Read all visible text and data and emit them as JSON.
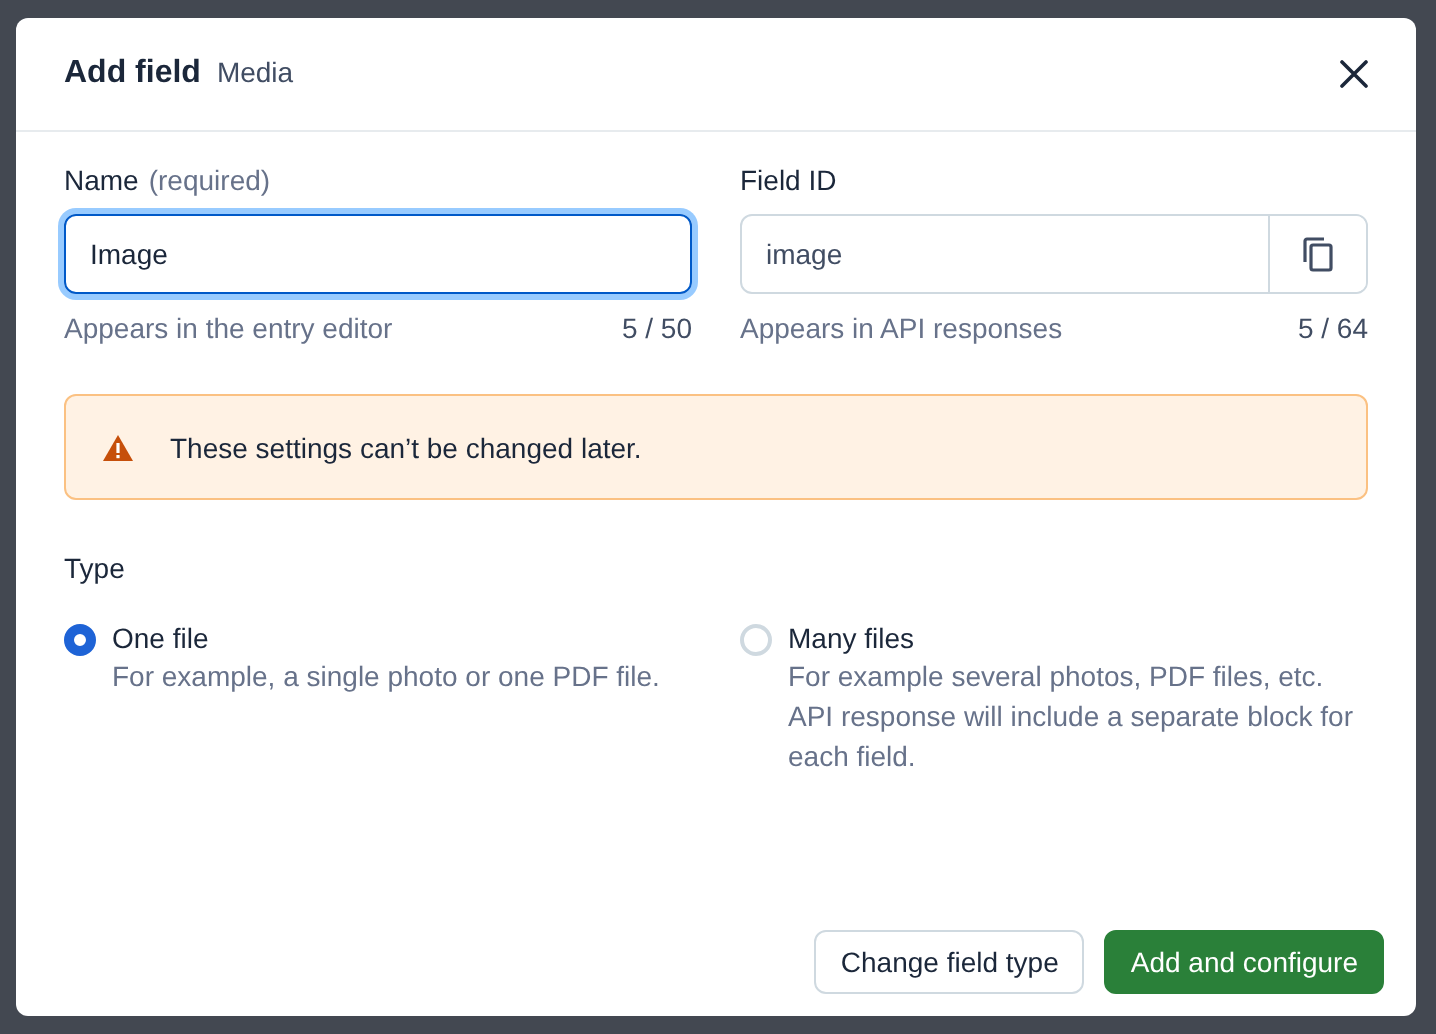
{
  "dialog": {
    "title": "Add field",
    "subtitle": "Media"
  },
  "fields": [
    {
      "label": "Name",
      "note": "(required)",
      "value": "Image",
      "focused": true,
      "help": "Appears in the entry editor",
      "count": "5 / 50",
      "copy": false
    },
    {
      "label": "Field ID",
      "value": "image",
      "focused": false,
      "help": "Appears in API responses",
      "count": "5 / 64",
      "copy": true
    }
  ],
  "warning": {
    "text": "These settings can’t be changed later."
  },
  "type": {
    "label": "Type",
    "options": [
      {
        "label": "One file",
        "description": "For example, a single photo or one PDF file.",
        "selected": true
      },
      {
        "label": "Many files",
        "description": "For example several photos, PDF files, etc. API response will include a separate block for each field.",
        "selected": false
      }
    ]
  },
  "buttons": [
    {
      "label": "Change field type",
      "kind": "secondary"
    },
    {
      "label": "Add and configure",
      "kind": "primary"
    }
  ]
}
